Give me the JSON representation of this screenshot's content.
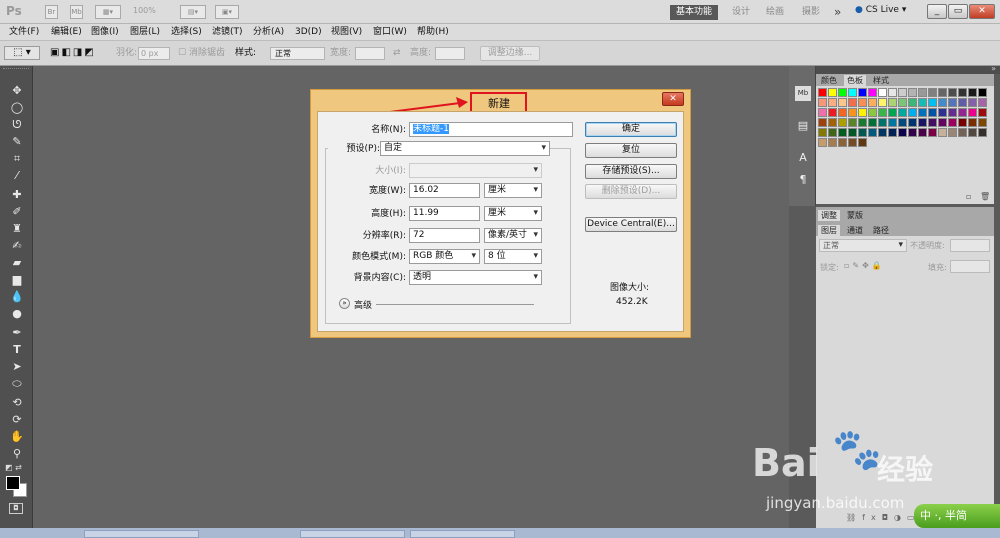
{
  "app": {
    "logo": "Ps",
    "zoom": "100%",
    "workspaces": [
      "基本功能",
      "设计",
      "绘画",
      "摄影"
    ],
    "more": "»",
    "cslive": "CS Live",
    "window_buttons": [
      "_",
      "▭",
      "✕"
    ]
  },
  "menubar": [
    "文件(F)",
    "编辑(E)",
    "图像(I)",
    "图层(L)",
    "选择(S)",
    "滤镜(T)",
    "分析(A)",
    "3D(D)",
    "视图(V)",
    "窗口(W)",
    "帮助(H)"
  ],
  "options": {
    "feather_label": "羽化:",
    "feather_value": "0 px",
    "antialias_label": "消除锯齿",
    "style_label": "样式:",
    "style_value": "正常",
    "width_label": "宽度:",
    "height_label": "高度:",
    "refine_edge": "调整边缘..."
  },
  "tools": [
    "move",
    "marquee",
    "lasso",
    "quick-select",
    "crop",
    "eyedropper",
    "healing",
    "brush",
    "clone-stamp",
    "history-brush",
    "eraser",
    "gradient",
    "blur",
    "dodge",
    "pen",
    "type",
    "path-select",
    "shape",
    "3d-rotate",
    "3d-orbit",
    "hand",
    "zoom"
  ],
  "panels": {
    "swatch_tabs": [
      "颜色",
      "色板",
      "样式"
    ],
    "adjust_tabs": [
      "调整",
      "蒙版"
    ],
    "layer_tabs": [
      "图层",
      "通道",
      "路径"
    ],
    "blend_mode": "正常",
    "opacity_label": "不透明度:",
    "lock_label": "锁定:",
    "fill_label": "填充:"
  },
  "swatch_colors": [
    "#ff0000",
    "#ffff00",
    "#00ff00",
    "#00ffff",
    "#0000ff",
    "#ff00ff",
    "#ffffff",
    "#e6e6e6",
    "#cccccc",
    "#b3b3b3",
    "#999999",
    "#808080",
    "#666666",
    "#4d4d4d",
    "#333333",
    "#1a1a1a",
    "#000000",
    "#f7977a",
    "#f9ad81",
    "#fdc68a",
    "#f26c4f",
    "#f68e55",
    "#fbaf5c",
    "#fff568",
    "#acd372",
    "#7cc576",
    "#3bb878",
    "#1abbb4",
    "#00bff3",
    "#438ccb",
    "#5574b9",
    "#605ca8",
    "#855fa8",
    "#a763a8",
    "#f06ea9",
    "#ed1c24",
    "#f26522",
    "#f7941d",
    "#fff200",
    "#8dc63f",
    "#39b54a",
    "#00a651",
    "#00a99d",
    "#00aeef",
    "#0072bc",
    "#0054a6",
    "#2e3192",
    "#662d91",
    "#92278f",
    "#ec008c",
    "#9e0b0f",
    "#a0410d",
    "#a3620a",
    "#aba000",
    "#598527",
    "#197b30",
    "#007236",
    "#00746b",
    "#0076a3",
    "#004a80",
    "#003471",
    "#1b1464",
    "#440e62",
    "#630460",
    "#9e005d",
    "#790000",
    "#7b2e00",
    "#7d4900",
    "#827b00",
    "#406618",
    "#005e20",
    "#005826",
    "#005952",
    "#005b7f",
    "#003663",
    "#002157",
    "#0d004c",
    "#32004b",
    "#4b0049",
    "#7b0046",
    "#c7b299",
    "#998675",
    "#736357",
    "#534741",
    "#37302a",
    "#c69c6d",
    "#a67c52",
    "#8c6239",
    "#754c24",
    "#603913"
  ],
  "dialog": {
    "title": "新建",
    "name_label": "名称(N):",
    "name_value": "未标题-1",
    "preset_label": "预设(P):",
    "preset_value": "自定",
    "size_label": "大小(I):",
    "width_label": "宽度(W):",
    "width_value": "16.02",
    "width_unit": "厘米",
    "height_label": "高度(H):",
    "height_value": "11.99",
    "height_unit": "厘米",
    "resolution_label": "分辨率(R):",
    "resolution_value": "72",
    "resolution_unit": "像素/英寸",
    "color_mode_label": "颜色模式(M):",
    "color_mode_value": "RGB 颜色",
    "bit_depth": "8 位",
    "background_label": "背景内容(C):",
    "background_value": "透明",
    "advanced": "高级",
    "ok": "确定",
    "reset": "复位",
    "save_preset": "存储预设(S)...",
    "delete_preset": "删除预设(D)...",
    "device_central": "Device Central(E)...",
    "image_size_label": "图像大小:",
    "image_size_value": "452.2K",
    "close": "✕"
  },
  "watermark": {
    "baidu": "Bai",
    "jingyan": "经验",
    "url": "jingyan.baidu.com"
  },
  "ime": "中 ·, 半简"
}
